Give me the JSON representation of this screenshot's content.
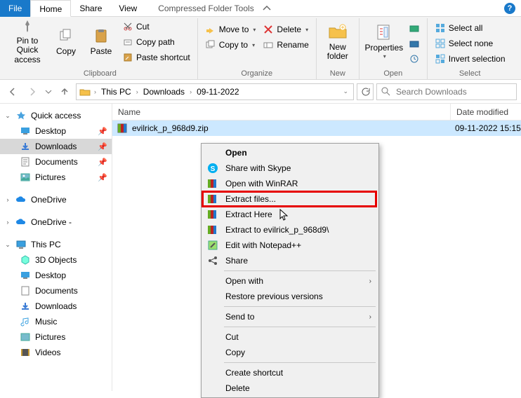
{
  "tabs": {
    "file": "File",
    "home": "Home",
    "share": "Share",
    "view": "View",
    "tool": "Compressed Folder Tools"
  },
  "ribbon": {
    "clipboard": {
      "label": "Clipboard",
      "pin": "Pin to Quick\naccess",
      "copy": "Copy",
      "paste": "Paste",
      "cut": "Cut",
      "copy_path": "Copy path",
      "paste_shortcut": "Paste shortcut"
    },
    "organize": {
      "label": "Organize",
      "move_to": "Move to",
      "copy_to": "Copy to",
      "delete": "Delete",
      "rename": "Rename"
    },
    "new": {
      "label": "New",
      "new_folder": "New\nfolder"
    },
    "open": {
      "label": "Open",
      "properties": "Properties"
    },
    "select": {
      "label": "Select",
      "all": "Select all",
      "none": "Select none",
      "invert": "Invert selection"
    }
  },
  "breadcrumb": {
    "items": [
      "This PC",
      "Downloads",
      "09-11-2022"
    ]
  },
  "search": {
    "placeholder": "Search Downloads"
  },
  "columns": {
    "name": "Name",
    "date": "Date modified"
  },
  "file": {
    "name": "evilrick_p_968d9.zip",
    "date": "09-11-2022 15:15"
  },
  "tree": {
    "quick": "Quick access",
    "quick_items": [
      "Desktop",
      "Downloads",
      "Documents",
      "Pictures"
    ],
    "onedrive": "OneDrive",
    "onedrive2": "OneDrive -",
    "thispc": "This PC",
    "pc_items": [
      "3D Objects",
      "Desktop",
      "Documents",
      "Downloads",
      "Music",
      "Pictures",
      "Videos"
    ]
  },
  "ctx": {
    "open": "Open",
    "skype": "Share with Skype",
    "winrar": "Open with WinRAR",
    "extract_files": "Extract files...",
    "extract_here": "Extract Here",
    "extract_to": "Extract to evilrick_p_968d9\\",
    "notepadpp": "Edit with Notepad++",
    "share": "Share",
    "open_with": "Open with",
    "restore": "Restore previous versions",
    "send_to": "Send to",
    "cut": "Cut",
    "copy": "Copy",
    "create_shortcut": "Create shortcut",
    "delete": "Delete"
  },
  "colors": {
    "accent": "#1979ca",
    "highlight": "#e60000",
    "select_row": "#cce8ff"
  }
}
